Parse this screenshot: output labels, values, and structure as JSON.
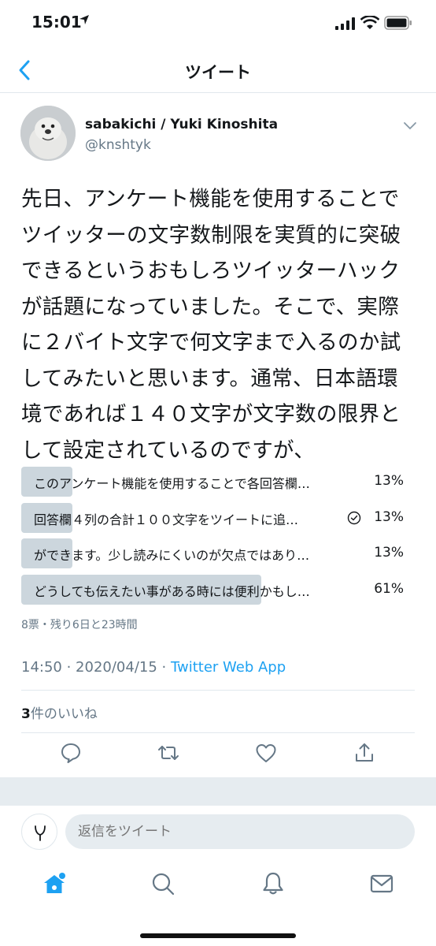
{
  "status_bar": {
    "time": "15:01"
  },
  "nav": {
    "title": "ツイート"
  },
  "author": {
    "name": "sabakichi / Yuki Kinoshita",
    "handle": "@knshtyk"
  },
  "tweet": {
    "lines": [
      "先日、アンケート機能を使用することで",
      "ツイッターの文字数制限を実質的に突破",
      "できるというおもしろツイッターハック",
      "が話題になっていました。そこで、実際",
      "に２バイト文字で何文字まで入るのか試",
      "してみたいと思います。通常、日本語環",
      "境であれば１４０文字が文字数の限界と",
      "して設定されているのですが、"
    ]
  },
  "poll": {
    "options": [
      {
        "label": "このアンケート機能を使用することで各回答欄…",
        "percent": "13%",
        "value": 13,
        "voted": false
      },
      {
        "label": "回答欄４列の合計１００文字をツイートに追…",
        "percent": "13%",
        "value": 13,
        "voted": true
      },
      {
        "label": "ができます。少し読みにくいのが欠点ではあり…",
        "percent": "13%",
        "value": 13,
        "voted": false
      },
      {
        "label": "どうしても伝えたい事がある時には便利かもし…",
        "percent": "61%",
        "value": 61,
        "voted": false
      }
    ],
    "meta": "8票・残り6日と23時間"
  },
  "tweet_meta": {
    "time": "14:50",
    "sep1": " · ",
    "date": "2020/04/15",
    "sep2": " · ",
    "source": "Twitter Web App"
  },
  "likes": {
    "count": "3",
    "label": "件のいいね"
  },
  "reply": {
    "placeholder": "返信をツイート"
  },
  "colors": {
    "accent": "#1da1f2",
    "poll_bar": "#ccd6dd",
    "secondary_text": "#657786"
  }
}
